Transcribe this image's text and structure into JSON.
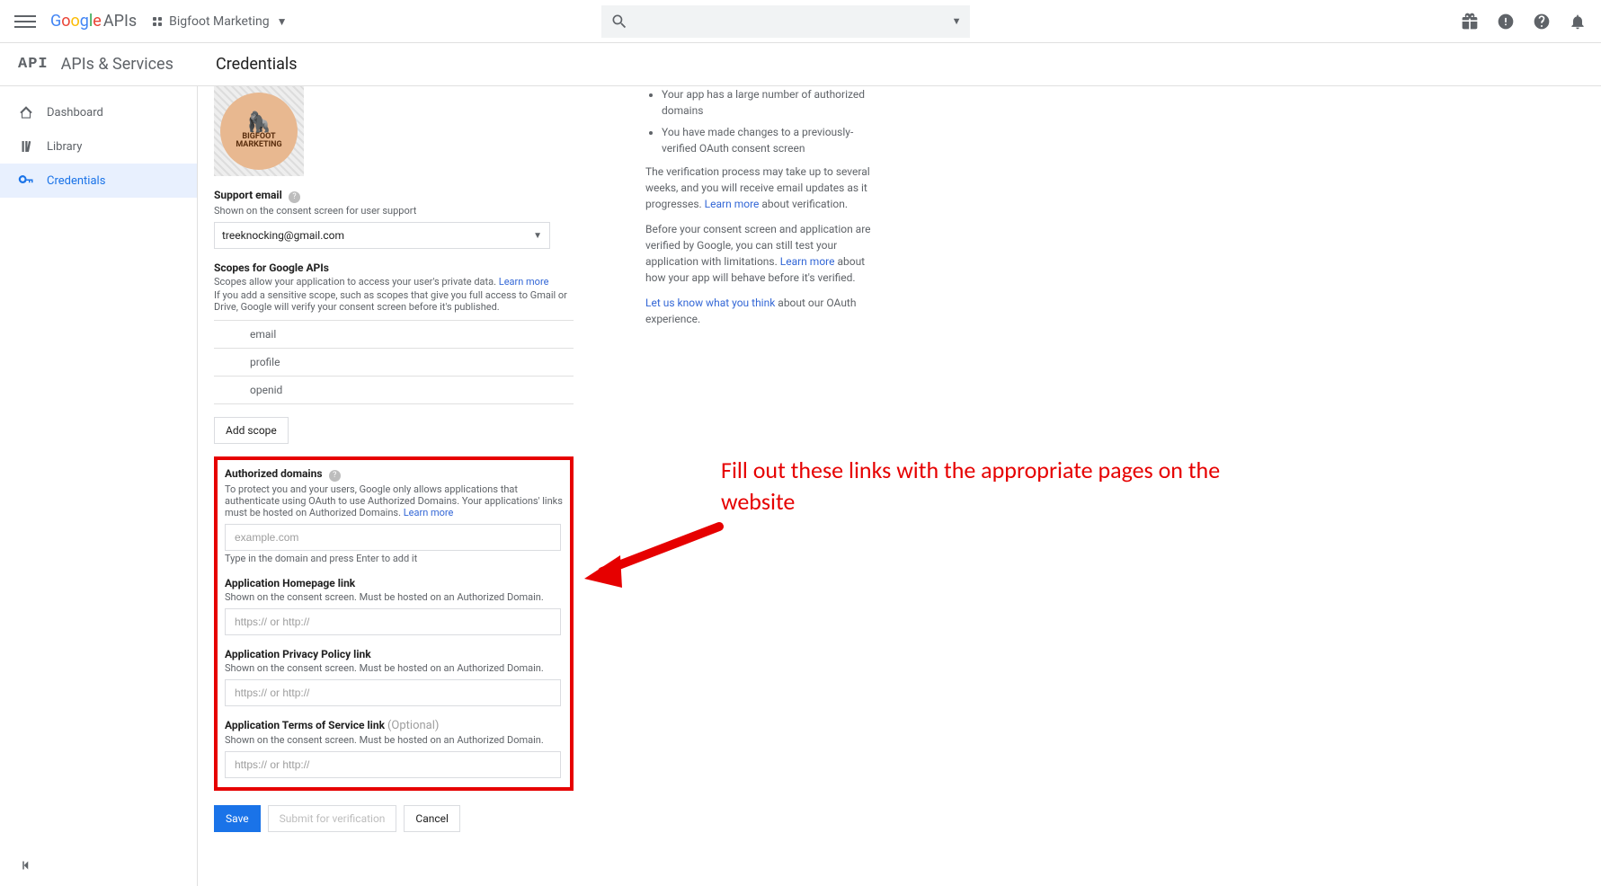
{
  "topbar": {
    "logo_text": "Google",
    "logo_suffix": "APIs",
    "project_name": "Bigfoot Marketing"
  },
  "section": {
    "api_badge": "API",
    "apis_services": "APIs & Services",
    "page_title": "Credentials"
  },
  "sidebar": {
    "items": [
      {
        "label": "Dashboard"
      },
      {
        "label": "Library"
      },
      {
        "label": "Credentials"
      }
    ]
  },
  "left": {
    "logo_line1": "BIGFOOT",
    "logo_line2": "MARKETING",
    "support_email_label": "Support email",
    "support_email_sub": "Shown on the consent screen for user support",
    "support_email_value": "treeknocking@gmail.com",
    "scopes_label": "Scopes for Google APIs",
    "scopes_sub1": "Scopes allow your application to access your user's private data. ",
    "scopes_learn": "Learn more",
    "scopes_sub2": "If you add a sensitive scope, such as scopes that give you full access to Gmail or Drive, Google will verify your consent screen before it's published.",
    "scopes": [
      "email",
      "profile",
      "openid"
    ],
    "add_scope": "Add scope",
    "auth_domains_label": "Authorized domains",
    "auth_domains_sub": "To protect you and your users, Google only allows applications that authenticate using OAuth to use Authorized Domains. Your applications' links must be hosted on Authorized Domains. ",
    "auth_domains_learn": "Learn more",
    "auth_domains_placeholder": "example.com",
    "auth_domains_hint": "Type in the domain and press Enter to add it",
    "homepage_label": "Application Homepage link",
    "homepage_sub": "Shown on the consent screen. Must be hosted on an Authorized Domain.",
    "link_placeholder": "https:// or http://",
    "privacy_label": "Application Privacy Policy link",
    "privacy_sub": "Shown on the consent screen. Must be hosted on an Authorized Domain.",
    "tos_label": "Application Terms of Service link ",
    "tos_optional": "(Optional)",
    "tos_sub": "Shown on the consent screen. Must be hosted on an Authorized Domain.",
    "save": "Save",
    "submit": "Submit for verification",
    "cancel": "Cancel"
  },
  "right": {
    "bullet1": "Your app has a large number of authorized domains",
    "bullet2": "You have made changes to a previously-verified OAuth consent screen",
    "p1a": "The verification process may take up to several weeks, and you will receive email updates as it progresses. ",
    "p1_link": "Learn more",
    "p1b": " about verification.",
    "p2a": "Before your consent screen and application are verified by Google, you can still test your application with limitations. ",
    "p2_link": "Learn more",
    "p2b": " about how your app will behave before it's verified.",
    "p3_link": "Let us know what you think",
    "p3b": " about our OAuth experience."
  },
  "annotation": "Fill out these links with the appropriate pages on the website"
}
